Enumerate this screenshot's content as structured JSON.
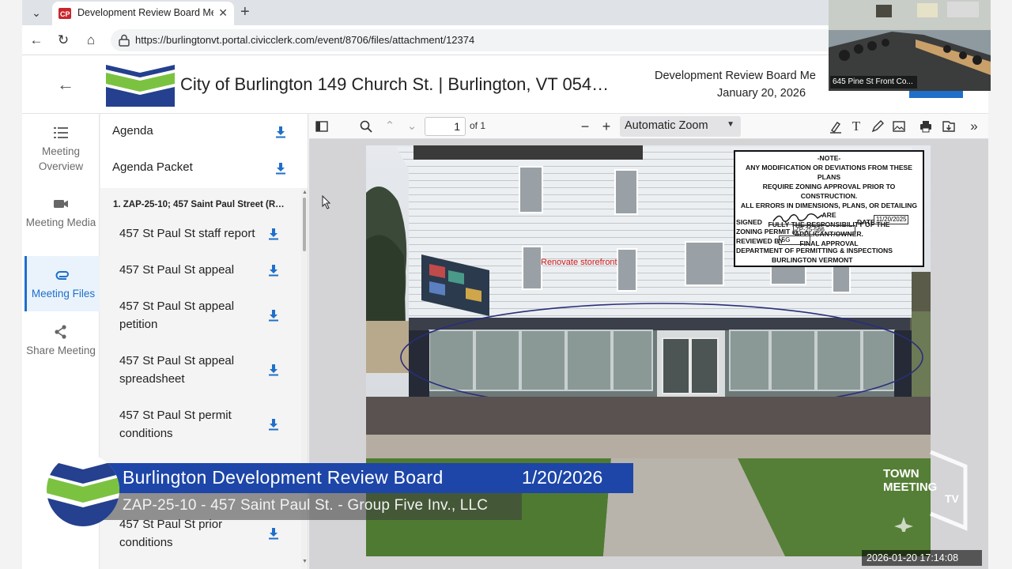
{
  "browser": {
    "tab_title": "Development Review Board Meet",
    "url": "https://burlingtonvt.portal.civicclerk.com/event/8706/files/attachment/12374"
  },
  "header": {
    "city_title": "City of Burlington 149 Church St. | Burlington, VT 054…",
    "meeting_title": "Development Review Board Me",
    "meeting_date": "January 20, 2026"
  },
  "rail": {
    "items": [
      {
        "label": "Meeting Overview",
        "icon": "list-icon"
      },
      {
        "label": "Meeting Media",
        "icon": "video-camera-icon"
      },
      {
        "label": "Meeting Files",
        "icon": "paperclip-icon"
      },
      {
        "label": "Share Meeting",
        "icon": "share-icon"
      }
    ]
  },
  "files": {
    "top": [
      "Agenda",
      "Agenda Packet"
    ],
    "section_heading": "1. ZAP-25-10; 457 Saint Paul Street (R…",
    "items": [
      "457 St Paul St staff report",
      "457 St Paul St appeal",
      "457 St Paul St appeal petition",
      "457 St Paul St appeal spreadsheet",
      "457 St Paul St permit conditions",
      "457 St Paul St prior conditions"
    ]
  },
  "pdf": {
    "page_number": "1",
    "page_of": "of 1",
    "zoom": "Automatic Zoom"
  },
  "document": {
    "note_heading": "-NOTE-",
    "note_lines": [
      "ANY MODIFICATION OR DEVIATIONS FROM THESE PLANS",
      "REQUIRE ZONING APPROVAL PRIOR TO CONSTRUCTION.",
      "ALL ERRORS IN DIMENSIONS, PLANS, OR DETAILING ARE",
      "FULLY THE RESPONSIBILITY OF THE APPLICANT/OWNER.",
      "FINAL APPROVAL"
    ],
    "signed_label": "SIGNED",
    "date_label": "DATE",
    "date_value": "11/20/2025",
    "permit_label": "ZONING PERMIT #",
    "permit_value": "ZP-25-566",
    "reviewed_label": "REVIEWED BY",
    "reviewed_value": "SG",
    "dept_line1": "DEPARTMENT OF PERMITTING & INSPECTIONS",
    "dept_line2": "BURLINGTON VERMONT",
    "annotation": "Renovate storefront"
  },
  "video": {
    "pip_label": "645 Pine St Front Co...",
    "lower_third_title": "Burlington Development Review Board",
    "lower_third_date": "1/20/2026",
    "lower_third_sub": "ZAP-25-10 - 457 Saint Paul St. - Group Five Inv., LLC",
    "watermark": "TOWN MEETING TV",
    "timestamp": "2026-01-20  17:14:08"
  },
  "colors": {
    "accent": "#1f6fc9",
    "logo_green": "#7cc241",
    "logo_navy": "#24408e",
    "lower_third": "#1d46a8"
  }
}
